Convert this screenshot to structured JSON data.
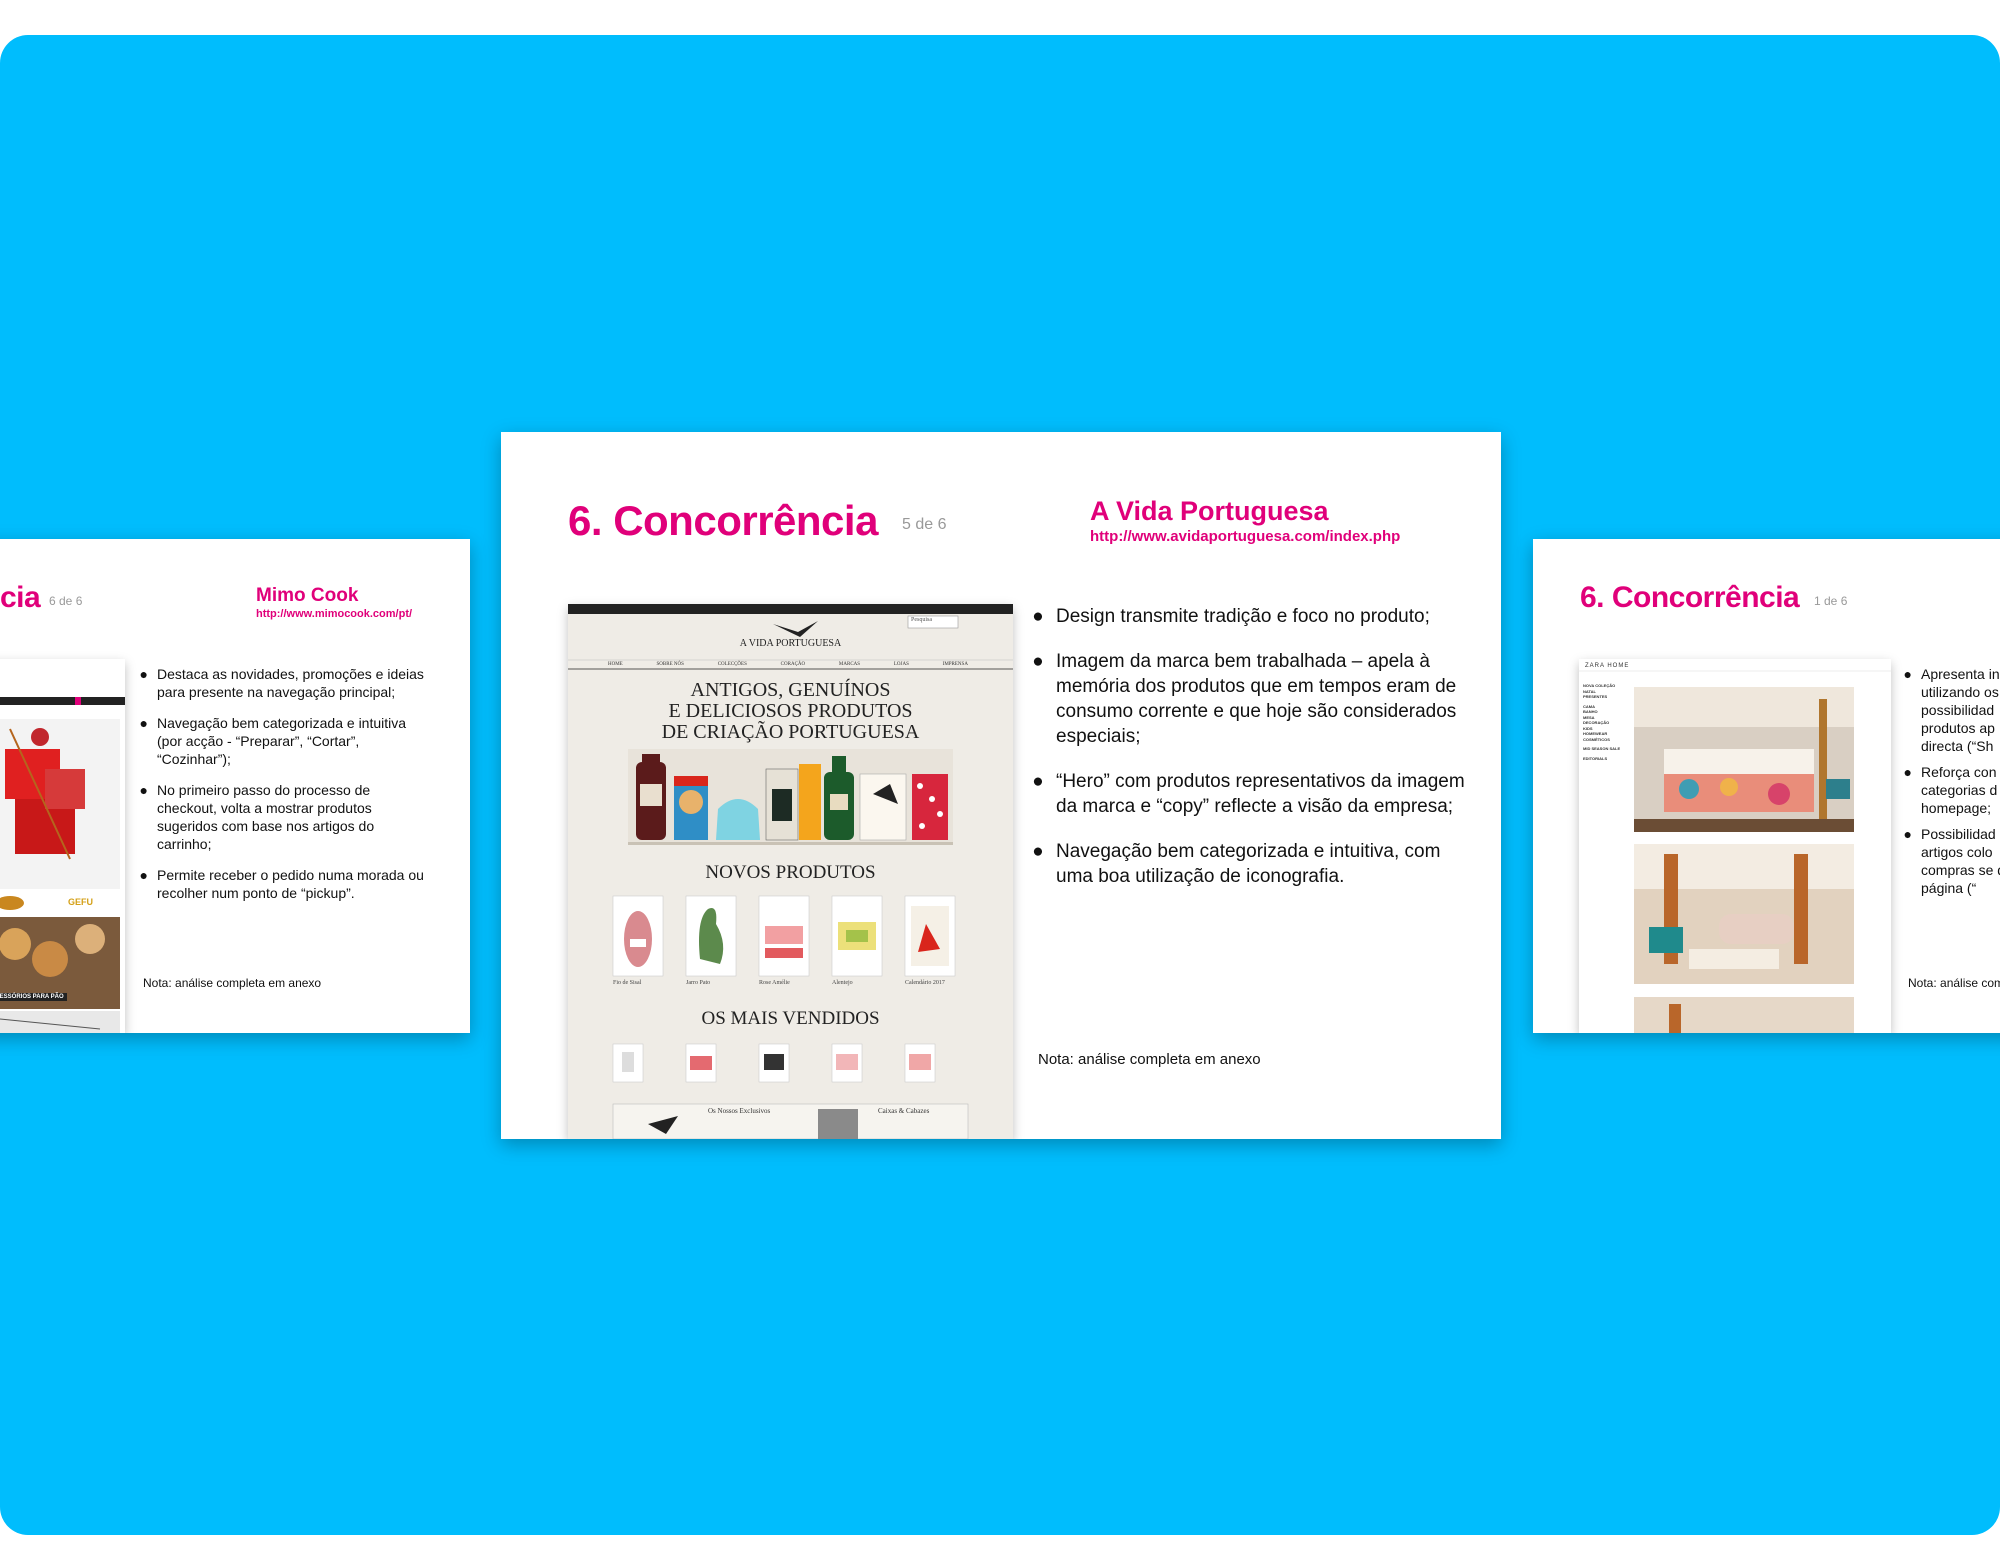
{
  "colors": {
    "background": "#00bdfd",
    "accent": "#e0007a",
    "slide": "#ffffff"
  },
  "left_slide": {
    "title_fragment": "cia",
    "page": "6 de 6",
    "brand": "Mimo Cook",
    "url": "http://www.mimocook.com/pt/",
    "bullets": [
      "Destaca as novidades, promoções e ideias para presente na navegação principal;",
      "Navegação bem categorizada e intuitiva (por acção - “Preparar”, “Cortar”, “Cozinhar”);",
      "No primeiro passo do processo de checkout, volta a mostrar produtos sugeridos com base nos artigos do carrinho;",
      "Permite receber o pedido numa morada ou recolher num ponto de “pickup”."
    ],
    "note": "Nota: análise completa em anexo",
    "shot": {
      "brand_label": "GEFU",
      "banner": "ACESSÓRIOS PARA PÃO"
    }
  },
  "center_slide": {
    "title": "6. Concorrência",
    "page": "5 de 6",
    "brand": "A Vida Portuguesa",
    "url": "http://www.avidaportuguesa.com/index.php",
    "bullets": [
      "Design transmite tradição e foco no produto;",
      "Imagem da marca bem trabalhada – apela à memória dos produtos que em tempos eram de consumo corrente e que hoje são considerados especiais;",
      "“Hero” com produtos representativos da imagem da marca e “copy” reflecte a visão da empresa;",
      "Navegação bem categorizada e intuitiva, com uma boa utilização de iconografia."
    ],
    "note": "Nota: análise completa em anexo",
    "shot": {
      "logo": "A VIDA PORTUGUESA",
      "search": "Pesquisa",
      "nav": [
        "HOME",
        "SOBRE NÓS",
        "COLECÇÕES",
        "CORAÇÃO",
        "MARCAS",
        "LOJAS",
        "IMPRENSA"
      ],
      "hero": [
        "ANTIGOS, GENUÍNOS",
        "E DELICIOSOS PRODUTOS",
        "DE CRIAÇÃO PORTUGUESA"
      ],
      "novos": "NOVOS PRODUTOS",
      "novos_items": [
        "Fio de Sisal",
        "Jarro Pato",
        "Rose Amélie",
        "Alentejo",
        "Calendário 2017"
      ],
      "mais": "OS MAIS VENDIDOS",
      "footer_a": "Os Nossos Exclusivos",
      "footer_b": "Caixas & Cabazes"
    }
  },
  "right_slide": {
    "title": "6. Concorrência",
    "page": "1 de 6",
    "bullets": [
      "Apresenta in utilizando os possibilidad produtos ap directa (“Sh",
      "Reforça con categorias d homepage;",
      "Possibilidad artigos colo compras se de página (“"
    ],
    "note": "Nota: análise com",
    "shot": {
      "logo": "ZARA HOME",
      "menu": [
        "NOVA COLEÇÃO",
        "NATAL",
        "PRESENTES",
        "CAMA",
        "BANHO",
        "MESA",
        "DECORAÇÃO",
        "KIDS",
        "HOMEWEAR",
        "COSMÉTICOS",
        "MID SEASON SALE",
        "EDITORIALS"
      ]
    }
  }
}
